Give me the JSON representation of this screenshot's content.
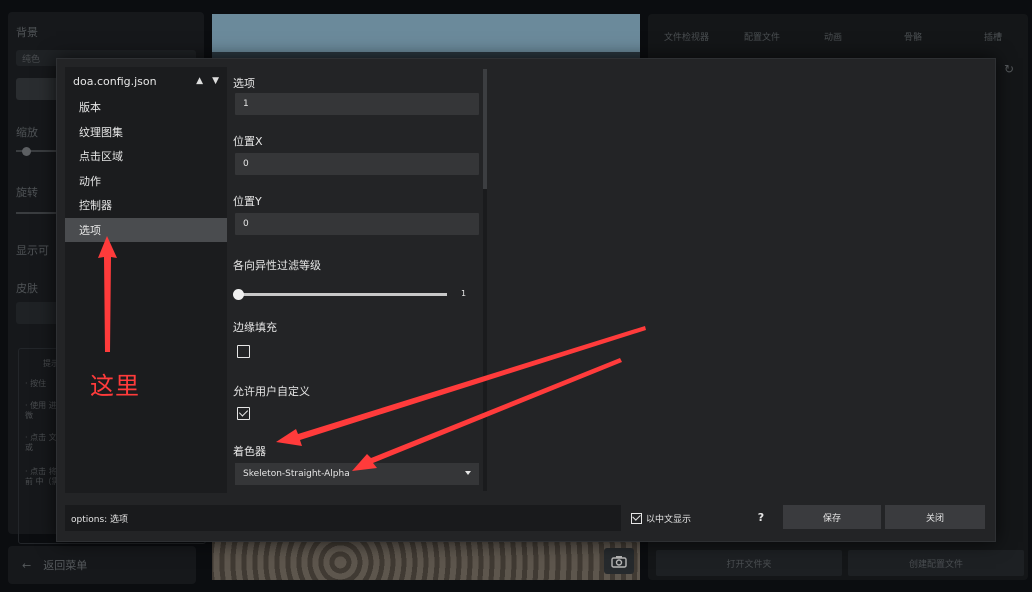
{
  "background": {
    "left_panel": {
      "background_title": "背景",
      "background_value": "纯色",
      "scale_title": "缩放",
      "rotate_title": "旋转",
      "show_label": "显示可",
      "skin_title": "皮肤",
      "hint_title": "提示",
      "hints": [
        "· 按住",
        "· 使用 进行微",
        "· 点击 文件或",
        "· 点击 将当前 中（需"
      ]
    },
    "back_button": "返回菜单",
    "right_panel": {
      "tabs": [
        "文件检视器",
        "配置文件",
        "动画",
        "骨骼",
        "插槽"
      ],
      "open_folder": "打开文件夹",
      "create_config": "创建配置文件"
    }
  },
  "modal": {
    "file_name": "doa.config.json",
    "nav_items": [
      "版本",
      "纹理图集",
      "点击区域",
      "动作",
      "控制器",
      "选项"
    ],
    "active_index": 5,
    "section_title": "选项",
    "fields": {
      "options_value": "1",
      "pos_x_label": "位置X",
      "pos_x_value": "0",
      "pos_y_label": "位置Y",
      "pos_y_value": "0",
      "aniso_label": "各向异性过滤等级",
      "aniso_value": "1",
      "aniso_level": 1,
      "edge_fill_label": "边缘填充",
      "edge_fill_checked": false,
      "user_custom_label": "允许用户自定义",
      "user_custom_checked": true,
      "shader_label": "着色器",
      "shader_value": "Skeleton-Straight-Alpha"
    },
    "footer": {
      "status": "options: 选项",
      "cn_toggle_label": "以中文显示",
      "help": "?",
      "save": "保存",
      "close": "关闭"
    }
  },
  "annotation": {
    "text": "这里",
    "color": "#ff3b3b"
  }
}
